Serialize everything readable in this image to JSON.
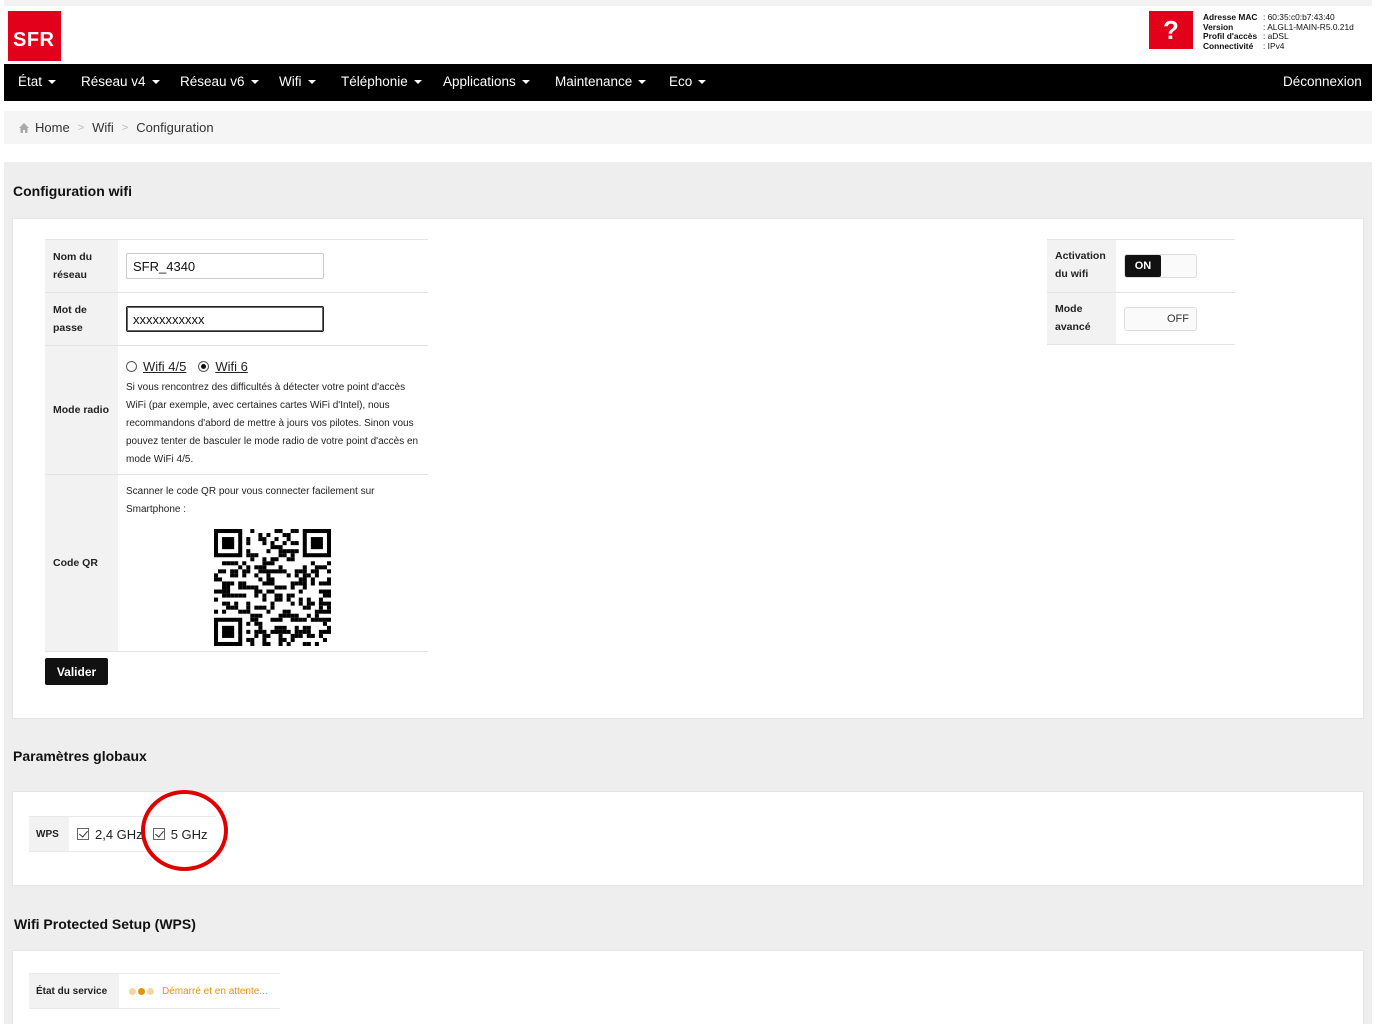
{
  "header": {
    "logo_text": "SFR",
    "help_glyph": "?",
    "info": [
      {
        "key": "Adresse MAC",
        "value": ": 60:35:c0:b7:43:40"
      },
      {
        "key": "Version",
        "value": ": ALGL1-MAIN-R5.0.21d"
      },
      {
        "key": "Profil d'accès",
        "value": ": aDSL"
      },
      {
        "key": "Connectivité",
        "value": ": IPv4"
      }
    ]
  },
  "nav": {
    "items": [
      "État",
      "Réseau v4",
      "Réseau v6",
      "Wifi",
      "Téléphonie",
      "Applications",
      "Maintenance",
      "Eco"
    ],
    "logout": "Déconnexion"
  },
  "breadcrumb": [
    "Home",
    "Wifi",
    "Configuration"
  ],
  "config": {
    "title": "Configuration wifi",
    "network_label": "Nom du réseau",
    "network_value": "SFR_4340",
    "password_label": "Mot de passe",
    "password_value": "xxxxxxxxxxx",
    "mode_label": "Mode radio",
    "mode_options": [
      "Wifi 4/5",
      "Wifi 6"
    ],
    "mode_selected": "Wifi 6",
    "mode_note": "Si vous rencontrez des difficultés à détecter votre point d'accès WiFi (par exemple, avec certaines cartes WiFi d'Intel), nous recommandons d'abord de mettre à jours vos pilotes. Sinon vous pouvez tenter de basculer le mode radio de votre point d'accès en mode WiFi 4/5.",
    "qr_label": "Code QR",
    "qr_note": "Scanner le code QR pour vous connecter facilement sur Smartphone :",
    "submit": "Valider",
    "activation_label": "Activation du wifi",
    "activation_state": "ON",
    "advanced_label": "Mode avancé",
    "advanced_state": "OFF"
  },
  "global": {
    "title": "Paramètres globaux",
    "wps_label": "WPS",
    "bands": [
      "2,4 GHz",
      "5 GHz"
    ]
  },
  "wps_section": {
    "title": "Wifi Protected Setup (WPS)",
    "state_label": "État du service",
    "state_value": "Démarré et en attente...",
    "state_color": "#e8920a"
  },
  "colors": {
    "brand": "#e2001a",
    "nav_bg": "#000000",
    "highlight_circle": "#e00000"
  }
}
